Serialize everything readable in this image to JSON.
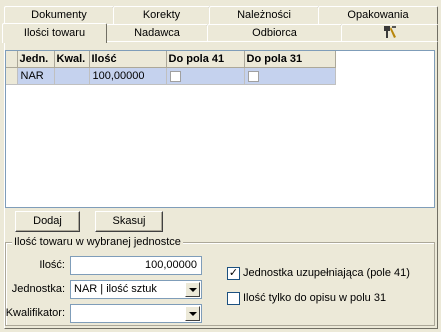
{
  "tabs_back": [
    {
      "label": "Dokumenty"
    },
    {
      "label": "Korekty"
    },
    {
      "label": "Należności"
    },
    {
      "label": "Opakowania"
    }
  ],
  "tabs_front": [
    {
      "label": "Ilości towaru"
    },
    {
      "label": "Nadawca"
    },
    {
      "label": "Odbiorca"
    }
  ],
  "tools_icon": "tools-icon",
  "grid": {
    "columns": [
      "Jedn.",
      "Kwal.",
      "Ilość",
      "Do pola 41",
      "Do pola 31"
    ],
    "rows": [
      {
        "jedn": "NAR",
        "kwal": "",
        "ilosc": "100,00000",
        "do41": false,
        "do31": false
      }
    ]
  },
  "buttons": {
    "add": "Dodaj",
    "delete": "Skasuj"
  },
  "group": {
    "caption": "Ilość towaru w wybranej jednostce",
    "qty_label": "Ilość:",
    "qty_value": "100,00000",
    "unit_label": "Jednostka:",
    "unit_value": "NAR | ilość sztuk",
    "qualifier_label": "Kwalifikator:",
    "qualifier_value": "",
    "supp_unit_label": "Jednostka uzupełniająca (pole 41)",
    "supp_unit_checked": true,
    "desc_only_label": "Ilość tylko do opisu w polu 31",
    "desc_only_checked": false
  }
}
